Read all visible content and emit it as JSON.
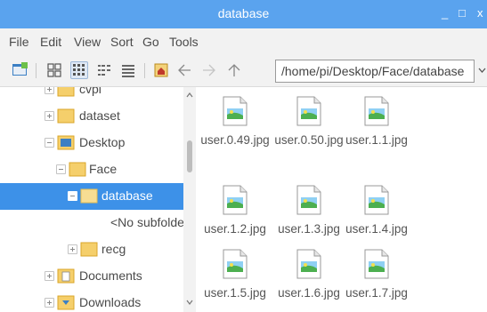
{
  "window": {
    "title": "database",
    "minimize": "_",
    "maximize": "□",
    "close": "x"
  },
  "menu": {
    "items": [
      "File",
      "Edit",
      "View",
      "Sort",
      "Go",
      "Tools"
    ]
  },
  "toolbar": {
    "icons": [
      "new-window-icon",
      "icon-view-icon",
      "thumbnail-view-icon",
      "compact-view-icon",
      "detailed-list-icon",
      "home-icon",
      "back-icon",
      "forward-icon",
      "up-icon",
      "chevron-down-icon"
    ],
    "path_value": "/home/pi/Desktop/Face/database"
  },
  "sidebar": {
    "items": [
      {
        "label": "cvpi",
        "expander": "plus",
        "icon": "folder-icon",
        "selected": false
      },
      {
        "label": "dataset",
        "expander": "plus",
        "icon": "folder-icon",
        "selected": false
      },
      {
        "label": "Desktop",
        "expander": "minus",
        "icon": "desktop-folder-icon",
        "selected": false
      },
      {
        "label": "Face",
        "expander": "minus",
        "icon": "folder-icon",
        "selected": false
      },
      {
        "label": "database",
        "expander": "minus",
        "icon": "folder-icon",
        "selected": true
      },
      {
        "label": "<No subfolders>",
        "expander": "none",
        "icon": "",
        "selected": false
      },
      {
        "label": "recg",
        "expander": "plus",
        "icon": "folder-icon",
        "selected": false
      },
      {
        "label": "Documents",
        "expander": "plus",
        "icon": "documents-folder-icon",
        "selected": false
      },
      {
        "label": "Downloads",
        "expander": "plus",
        "icon": "downloads-folder-icon",
        "selected": false
      }
    ]
  },
  "files": [
    {
      "name": "user.0.49.jpg",
      "icon": "image-file-icon"
    },
    {
      "name": "user.0.50.jpg",
      "icon": "image-file-icon"
    },
    {
      "name": "user.1.1.jpg",
      "icon": "image-file-icon"
    },
    {
      "name": "user.1.2.jpg",
      "icon": "image-file-icon"
    },
    {
      "name": "user.1.3.jpg",
      "icon": "image-file-icon"
    },
    {
      "name": "user.1.4.jpg",
      "icon": "image-file-icon"
    },
    {
      "name": "user.1.5.jpg",
      "icon": "image-file-icon"
    },
    {
      "name": "user.1.6.jpg",
      "icon": "image-file-icon"
    },
    {
      "name": "user.1.7.jpg",
      "icon": "image-file-icon"
    }
  ],
  "colors": {
    "titlebar": "#5aa3ee",
    "selection": "#3d91e8",
    "folder": "#f5cf6b"
  }
}
